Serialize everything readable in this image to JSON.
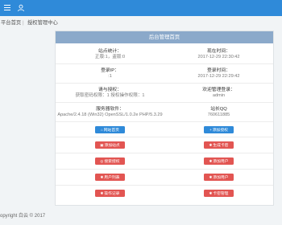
{
  "breadcrumb": {
    "home": "平台首页",
    "sep": "|",
    "current": "授权管理中心"
  },
  "panel": {
    "title": "后台管理首页"
  },
  "stats": [
    {
      "label": "站点统计：",
      "value": "正版:1，盗版:0"
    },
    {
      "label": "现在时间：",
      "value": "2017-12-29 22:30:42"
    },
    {
      "label": "登录IP：",
      "value": ":1"
    },
    {
      "label": "登录时间：",
      "value": "2017-12-29 22:29:42"
    },
    {
      "label": "请与授权：",
      "value": "获取密码权限：1 授权操作权限：1"
    },
    {
      "label": "欢迎管理登录：",
      "value": "admin"
    },
    {
      "label": "服务器软件：",
      "value": "Apache/2.4.18 (Win32) OpenSSL/1.0.2e PHP/5.3.29"
    },
    {
      "label": "站长QQ",
      "value": "760611885"
    }
  ],
  "buttons": [
    {
      "label": "网站首页",
      "icon": "home-icon",
      "glyph": "⌂",
      "color": "blue"
    },
    {
      "label": "添加授权",
      "icon": "plus-icon",
      "glyph": "+",
      "color": "blue"
    },
    {
      "label": "添加站点",
      "icon": "add-site-icon",
      "glyph": "▣",
      "color": "red"
    },
    {
      "label": "生成卡密",
      "icon": "key-icon",
      "glyph": "✱",
      "color": "red"
    },
    {
      "label": "搜索授权",
      "icon": "search-icon",
      "glyph": "◎",
      "color": "red"
    },
    {
      "label": "添加用户",
      "icon": "add-user-icon",
      "glyph": "✱",
      "color": "red"
    },
    {
      "label": "用户列表",
      "icon": "list-icon",
      "glyph": "✱",
      "color": "red"
    },
    {
      "label": "添加用户",
      "icon": "add-user-icon",
      "glyph": "✱",
      "color": "red"
    },
    {
      "label": "操作记录",
      "icon": "record-icon",
      "glyph": "✱",
      "color": "red"
    },
    {
      "label": "卡密管理",
      "icon": "card-icon",
      "glyph": "✱",
      "color": "red"
    }
  ],
  "footer": {
    "text": "opyright 白云 © 2017"
  },
  "colors": {
    "topbar": "#2f8ad9",
    "header": "#8ba9ca",
    "blue": "#2f8ad9",
    "red": "#e25552"
  }
}
